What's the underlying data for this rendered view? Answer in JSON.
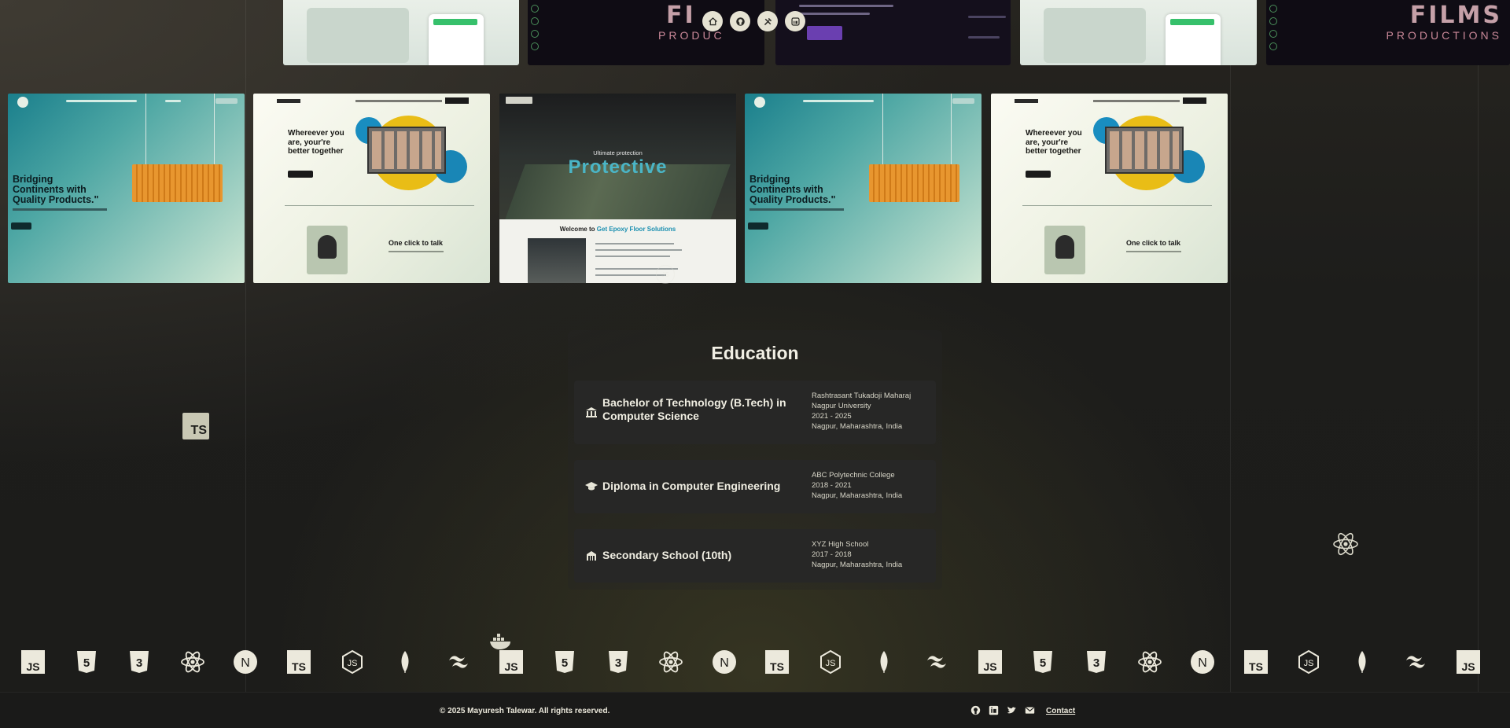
{
  "top_strip": {
    "films_word": "FILMS",
    "films_sub": "PRODUCTIONS",
    "films_word_partial": "FI",
    "films_sub_partial": "PRODUC"
  },
  "floating_nav": [
    "home-icon",
    "github-icon",
    "tools-icon",
    "linkedin-icon"
  ],
  "projects": {
    "teal_headline": "Bridging Continents with Quality Products.\"",
    "cream_headline": "Whereever you are, your're better together",
    "cream_tagline": "One click to talk",
    "dark_kicker": "Ultimate protection",
    "dark_title": "Protective",
    "dark_welcome_prefix": "Welcome to ",
    "dark_welcome_brand": "Get Epoxy Floor Solutions"
  },
  "education": {
    "title": "Education",
    "items": [
      {
        "icon": "university-icon",
        "degree": "Bachelor of Technology (B.Tech) in Computer Science",
        "institution": "Rashtrasant Tukadoji Maharaj Nagpur University",
        "years": "2021 - 2025",
        "location": "Nagpur, Maharashtra, India"
      },
      {
        "icon": "graduation-cap-icon",
        "degree": "Diploma in Computer Engineering",
        "institution": "ABC Polytechnic College",
        "years": "2018 - 2021",
        "location": "Nagpur, Maharashtra, India"
      },
      {
        "icon": "school-icon",
        "degree": "Secondary School (10th)",
        "institution": "XYZ High School",
        "years": "2017 - 2018",
        "location": "Nagpur, Maharashtra, India"
      }
    ]
  },
  "floating_icons": {
    "ts_label": "TS"
  },
  "tech_marquee": {
    "labels": {
      "js": "JS",
      "ts": "TS",
      "html": "5",
      "css": "3",
      "next": "N"
    },
    "sequence": [
      "javascript",
      "html5",
      "css3",
      "react",
      "nextjs",
      "typescript",
      "nodejs",
      "mongodb",
      "tailwind",
      "javascript",
      "html5",
      "css3",
      "react",
      "nextjs",
      "typescript",
      "nodejs",
      "mongodb",
      "tailwind",
      "javascript",
      "html5",
      "css3",
      "react",
      "nextjs",
      "typescript",
      "nodejs",
      "mongodb",
      "tailwind",
      "javascript"
    ]
  },
  "footer": {
    "copyright": "© 2025 Mayuresh Talewar. All rights reserved.",
    "socials": [
      "github-icon",
      "linkedin-icon",
      "twitter-icon",
      "mail-icon"
    ],
    "contact_label": "Contact"
  },
  "colors": {
    "background": "#1f1e1b",
    "card": "#272726",
    "icon_cream": "#e6e3d3",
    "accent_teal": "#4ab5c6"
  }
}
